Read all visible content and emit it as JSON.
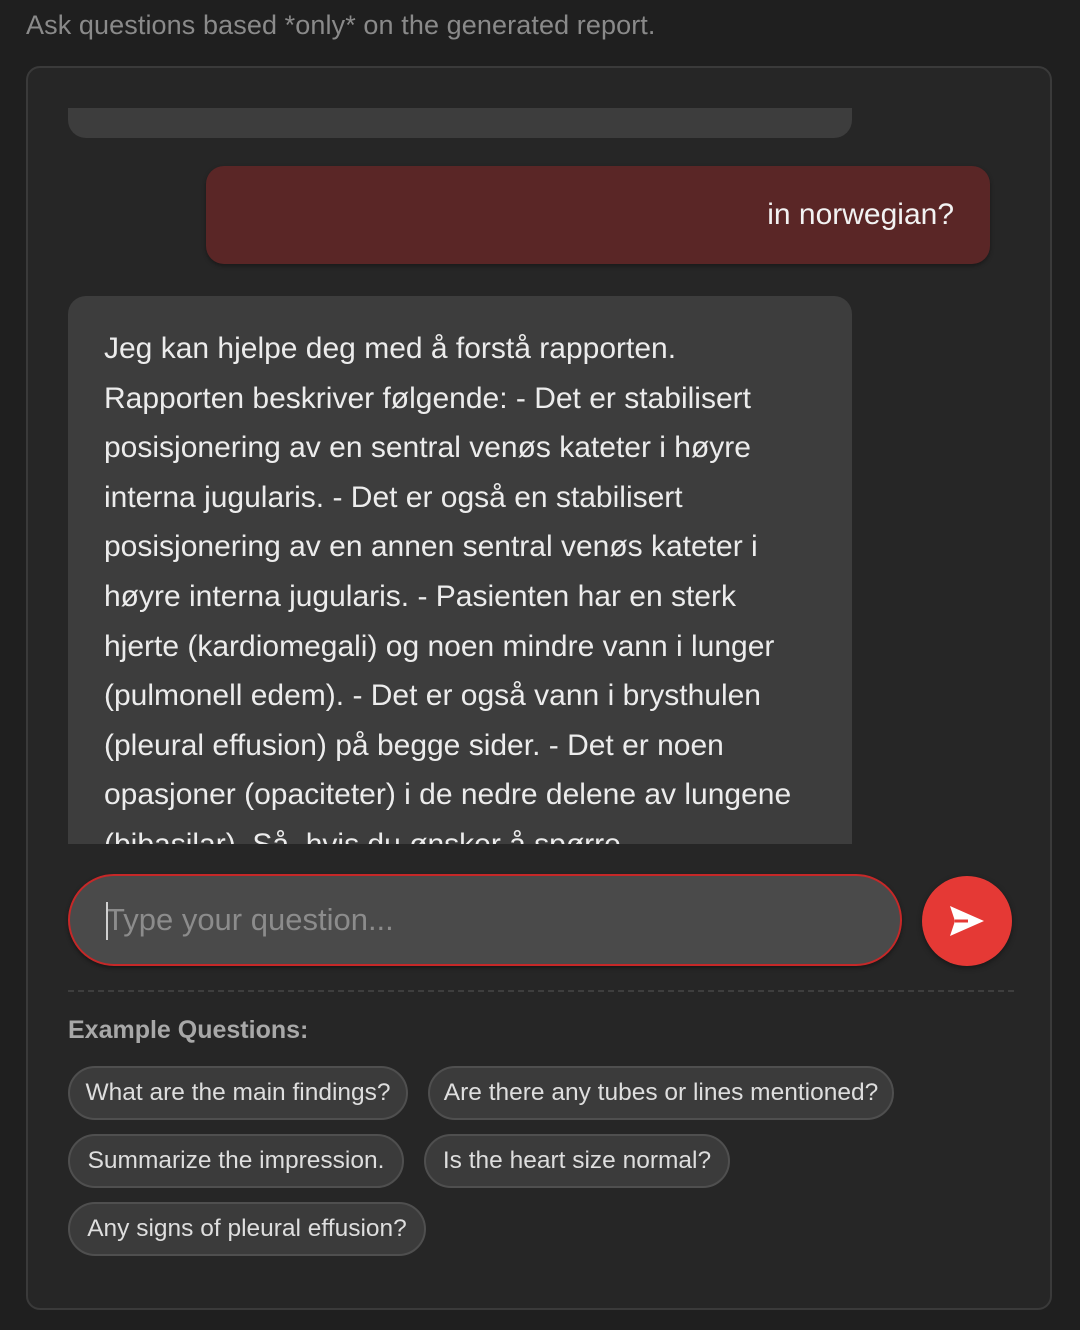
{
  "header": {
    "hint": "Ask questions based *only* on the generated report."
  },
  "chat": {
    "user_message": "in norwegian?",
    "bot_message": "Jeg kan hjelpe deg med å forstå rapporten. Rapporten beskriver følgende: - Det er stabilisert posisjonering av en sentral venøs kateter i høyre interna jugularis. - Det er også en stabilisert posisjonering av en annen sentral venøs kateter i høyre interna jugularis. - Pasienten har en sterk hjerte (kardiomegali) og noen mindre vann i lunger (pulmonell edem). - Det er også vann i brysthulen (pleural effusion) på begge sider. - Det er noen opasjoner (opaciteter) i de nedre delene av lungene (bibasilar). Så, hvis du ønsker å spørre"
  },
  "input": {
    "placeholder": "Type your question...",
    "value": ""
  },
  "send": {
    "icon": "send-icon"
  },
  "examples": {
    "title": "Example Questions:",
    "items": [
      "What are the main findings?",
      "Are there any tubes or lines mentioned?",
      "Summarize the impression.",
      "Is the heart size normal?",
      "Any signs of pleural effusion?"
    ]
  },
  "colors": {
    "background": "#1f1f1f",
    "user_bubble": "#5a2626",
    "bot_bubble": "#3d3d3d",
    "accent": "#e53935"
  }
}
